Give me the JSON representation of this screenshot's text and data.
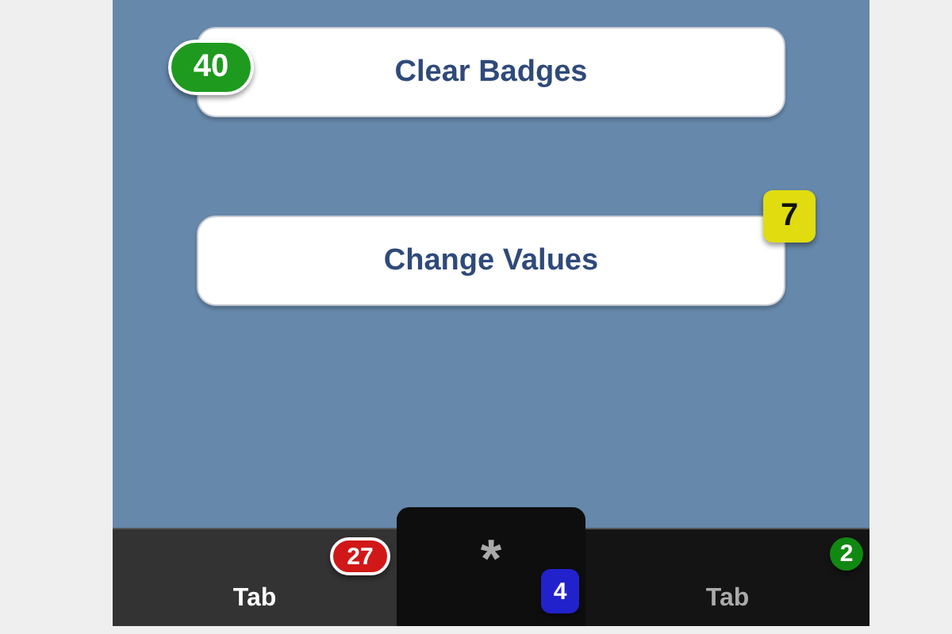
{
  "buttons": [
    {
      "label": "Clear Badges",
      "badge": {
        "text": "40",
        "color": "#1e9a1e",
        "kind": "pill"
      }
    },
    {
      "label": "Change Values",
      "badge": {
        "text": "7",
        "color": "#e0dc10",
        "kind": "square"
      }
    }
  ],
  "tabs": [
    {
      "kind": "tab",
      "label": "Tab",
      "selected": true,
      "badge": {
        "text": "27",
        "color": "#d01818",
        "kind": "pill"
      }
    },
    {
      "kind": "center",
      "label": "*",
      "selected": false,
      "badge": {
        "text": "4",
        "color": "#2222cc",
        "kind": "square"
      }
    },
    {
      "kind": "tab",
      "label": "Tab",
      "selected": false,
      "badge": {
        "text": "2",
        "color": "#118811",
        "kind": "circle"
      }
    }
  ]
}
